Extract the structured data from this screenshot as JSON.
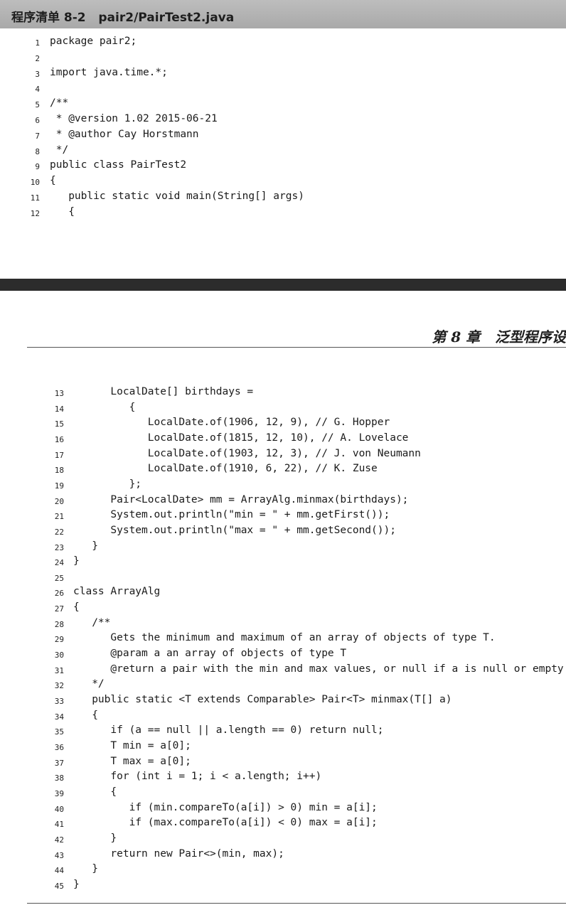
{
  "listing": {
    "title": "程序清单 8-2   pair2/PairTest2.java"
  },
  "chapter_header": "第 8 章   泛型程序设",
  "code_part1": [
    {
      "n": "1",
      "text": "package pair2;"
    },
    {
      "n": "2",
      "text": ""
    },
    {
      "n": "3",
      "text": "import java.time.*;"
    },
    {
      "n": "4",
      "text": ""
    },
    {
      "n": "5",
      "text": "/**"
    },
    {
      "n": "6",
      "text": " * @version 1.02 2015-06-21"
    },
    {
      "n": "7",
      "text": " * @author Cay Horstmann"
    },
    {
      "n": "8",
      "text": " */"
    },
    {
      "n": "9",
      "text": "public class PairTest2"
    },
    {
      "n": "10",
      "text": "{"
    },
    {
      "n": "11",
      "text": "   public static void main(String[] args)"
    },
    {
      "n": "12",
      "text": "   {"
    }
  ],
  "code_part2": [
    {
      "n": "13",
      "text": "      LocalDate[] birthdays ="
    },
    {
      "n": "14",
      "text": "         {"
    },
    {
      "n": "15",
      "text": "            LocalDate.of(1906, 12, 9), // G. Hopper"
    },
    {
      "n": "16",
      "text": "            LocalDate.of(1815, 12, 10), // A. Lovelace"
    },
    {
      "n": "17",
      "text": "            LocalDate.of(1903, 12, 3), // J. von Neumann"
    },
    {
      "n": "18",
      "text": "            LocalDate.of(1910, 6, 22), // K. Zuse"
    },
    {
      "n": "19",
      "text": "         };"
    },
    {
      "n": "20",
      "text": "      Pair<LocalDate> mm = ArrayAlg.minmax(birthdays);"
    },
    {
      "n": "21",
      "text": "      System.out.println(\"min = \" + mm.getFirst());"
    },
    {
      "n": "22",
      "text": "      System.out.println(\"max = \" + mm.getSecond());"
    },
    {
      "n": "23",
      "text": "   }"
    },
    {
      "n": "24",
      "text": "}"
    },
    {
      "n": "25",
      "text": ""
    },
    {
      "n": "26",
      "text": "class ArrayAlg"
    },
    {
      "n": "27",
      "text": "{"
    },
    {
      "n": "28",
      "text": "   /**"
    },
    {
      "n": "29",
      "text": "      Gets the minimum and maximum of an array of objects of type T."
    },
    {
      "n": "30",
      "text": "      @param a an array of objects of type T"
    },
    {
      "n": "31",
      "text": "      @return a pair with the min and max values, or null if a is null or empty"
    },
    {
      "n": "32",
      "text": "   */"
    },
    {
      "n": "33",
      "text": "   public static <T extends Comparable> Pair<T> minmax(T[] a)"
    },
    {
      "n": "34",
      "text": "   {"
    },
    {
      "n": "35",
      "text": "      if (a == null || a.length == 0) return null;"
    },
    {
      "n": "36",
      "text": "      T min = a[0];"
    },
    {
      "n": "37",
      "text": "      T max = a[0];"
    },
    {
      "n": "38",
      "text": "      for (int i = 1; i < a.length; i++)"
    },
    {
      "n": "39",
      "text": "      {"
    },
    {
      "n": "40",
      "text": "         if (min.compareTo(a[i]) > 0) min = a[i];"
    },
    {
      "n": "41",
      "text": "         if (max.compareTo(a[i]) < 0) max = a[i];"
    },
    {
      "n": "42",
      "text": "      }"
    },
    {
      "n": "43",
      "text": "      return new Pair<>(min, max);"
    },
    {
      "n": "44",
      "text": "   }"
    },
    {
      "n": "45",
      "text": "}"
    }
  ]
}
